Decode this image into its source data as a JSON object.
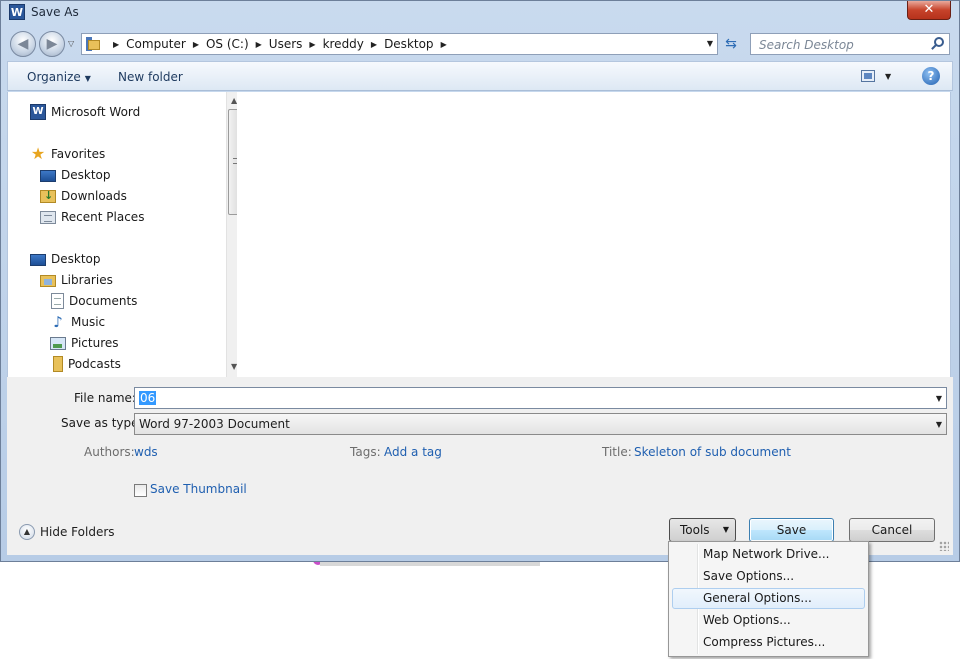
{
  "window": {
    "title": "Save As",
    "app_icon_letter": "W",
    "close_glyph": "✕"
  },
  "nav": {
    "back_glyph": "◀",
    "forward_glyph": "▶",
    "breadcrumbs": [
      "Computer",
      "OS (C:)",
      "Users",
      "kreddy",
      "Desktop"
    ],
    "search_placeholder": "Search Desktop"
  },
  "toolbar": {
    "organize_label": "Organize",
    "new_folder_label": "New folder",
    "help_glyph": "?"
  },
  "sidebar": {
    "items": [
      {
        "label": "Microsoft Word",
        "icon": "word-icon"
      },
      {
        "label": "Favorites",
        "icon": "star-icon"
      },
      {
        "label": "Desktop",
        "icon": "desktop-icon"
      },
      {
        "label": "Downloads",
        "icon": "downloads-icon"
      },
      {
        "label": "Recent Places",
        "icon": "recent-places-icon"
      },
      {
        "label": "Desktop",
        "icon": "desktop-icon"
      },
      {
        "label": "Libraries",
        "icon": "libraries-icon"
      },
      {
        "label": "Documents",
        "icon": "documents-icon"
      },
      {
        "label": "Music",
        "icon": "music-icon"
      },
      {
        "label": "Pictures",
        "icon": "pictures-icon"
      },
      {
        "label": "Podcasts",
        "icon": "podcasts-icon"
      }
    ]
  },
  "form": {
    "file_name_label": "File name:",
    "file_name_value": "06",
    "save_as_type_label": "Save as type:",
    "save_as_type_value": "Word 97-2003 Document",
    "authors_label": "Authors:",
    "authors_value": "wds",
    "tags_label": "Tags:",
    "tags_value": "Add a tag",
    "title_label": "Title:",
    "title_value": "Skeleton of sub document",
    "save_thumbnail_label": "Save Thumbnail"
  },
  "footer": {
    "hide_folders_label": "Hide Folders",
    "tools_label": "Tools",
    "save_label": "Save",
    "cancel_label": "Cancel"
  },
  "tools_menu": {
    "items": [
      "Map Network Drive...",
      "Save Options...",
      "General Options...",
      "Web Options...",
      "Compress Pictures..."
    ],
    "highlighted_index": 2
  }
}
